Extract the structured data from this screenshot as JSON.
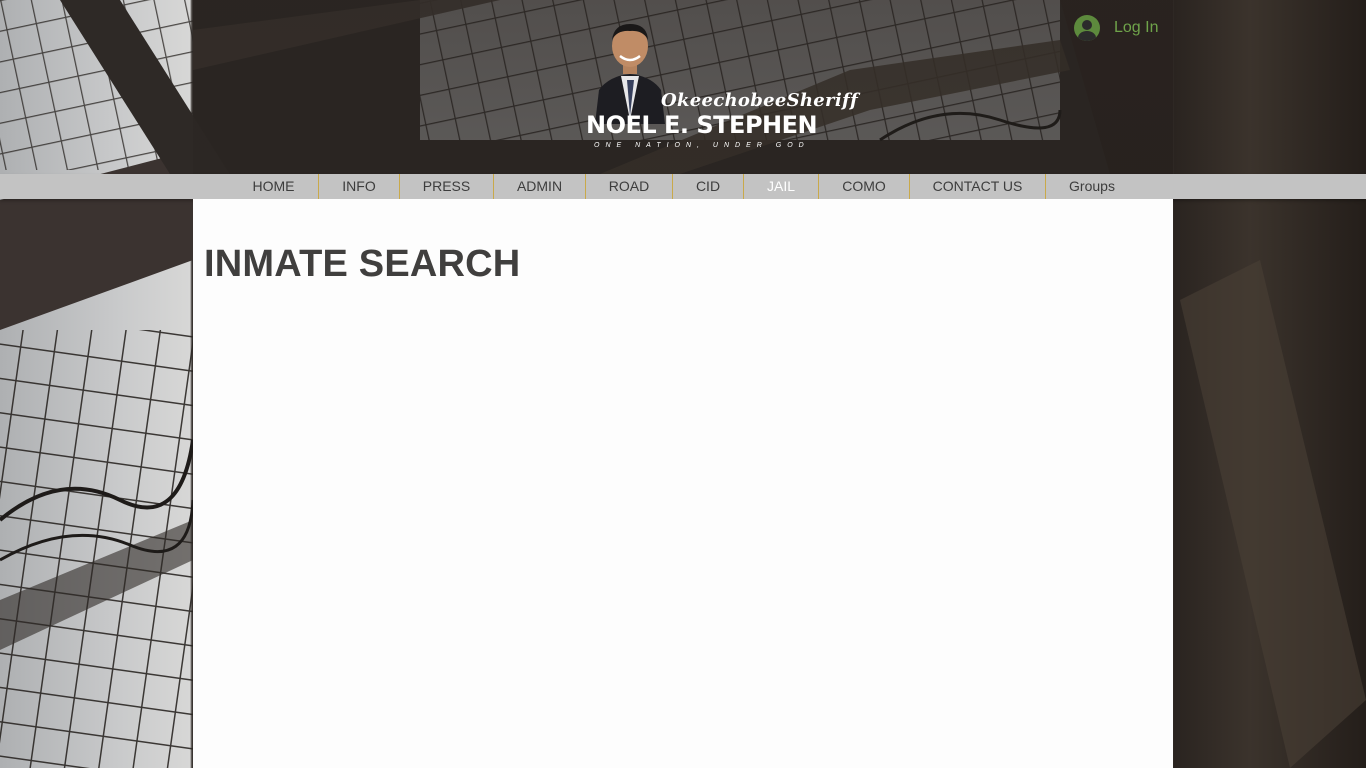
{
  "header": {
    "login_label": "Log In",
    "logo": {
      "script_text": "OkeechobeeSheriff",
      "name_text": "NOEL E. STEPHEN",
      "motto_text": "ONE NATION, UNDER GOD"
    }
  },
  "nav": {
    "items": [
      {
        "label": "HOME"
      },
      {
        "label": "INFO"
      },
      {
        "label": "PRESS"
      },
      {
        "label": "ADMIN"
      },
      {
        "label": "ROAD"
      },
      {
        "label": "CID"
      },
      {
        "label": "JAIL"
      },
      {
        "label": "COMO"
      },
      {
        "label": "CONTACT US"
      },
      {
        "label": "Groups"
      }
    ],
    "active": "JAIL"
  },
  "main": {
    "page_title": "INMATE SEARCH"
  },
  "colors": {
    "accent_green": "#6fa34a",
    "nav_background": "#c3c3c3",
    "nav_divider": "#c9a94a",
    "title_color": "#403f3e"
  },
  "icons": {
    "login": "user-avatar-icon"
  }
}
